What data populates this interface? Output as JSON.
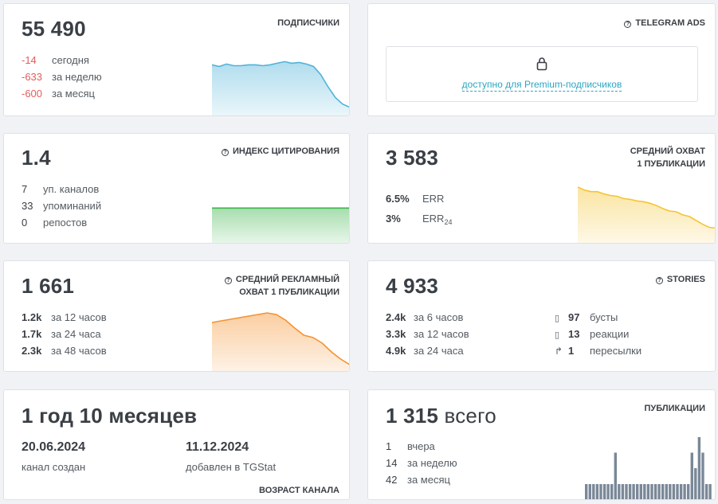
{
  "subscribers": {
    "value": "55 490",
    "label": "ПОДПИСЧИКИ",
    "stats": [
      {
        "value": "-14",
        "text": "сегодня"
      },
      {
        "value": "-633",
        "text": "за неделю"
      },
      {
        "value": "-600",
        "text": "за месяц"
      }
    ],
    "color": "#4fb3d9"
  },
  "ads": {
    "label": "TELEGRAM ADS",
    "locked_text": "доступно для Premium-подписчиков"
  },
  "citation": {
    "value": "1.4",
    "label": "ИНДЕКС ЦИТИРОВАНИЯ",
    "stats": [
      {
        "value": "7",
        "text": "уп. каналов"
      },
      {
        "value": "33",
        "text": "упоминаний"
      },
      {
        "value": "0",
        "text": "репостов"
      }
    ],
    "color": "#3cb54a"
  },
  "reach": {
    "value": "3 583",
    "label_line1": "СРЕДНИЙ ОХВАТ",
    "label_line2": "1 ПУБЛИКАЦИИ",
    "stats": [
      {
        "value": "6.5%",
        "text": "ERR",
        "sub": ""
      },
      {
        "value": "3%",
        "text": "ERR",
        "sub": "24"
      }
    ],
    "color": "#f5c431"
  },
  "ad_reach": {
    "value": "1 661",
    "label_line1": "СРЕДНИЙ РЕКЛАМНЫЙ",
    "label_line2": "ОХВАТ 1 ПУБЛИКАЦИИ",
    "stats": [
      {
        "value": "1.2k",
        "text": "за 12 часов"
      },
      {
        "value": "1.7k",
        "text": "за 24 часа"
      },
      {
        "value": "2.3k",
        "text": "за 48 часов"
      }
    ],
    "color": "#f5922f"
  },
  "stories": {
    "value": "4 933",
    "label": "STORIES",
    "stats": [
      {
        "value": "2.4k",
        "text": "за 6 часов"
      },
      {
        "value": "3.3k",
        "text": "за 12 часов"
      },
      {
        "value": "4.9k",
        "text": "за 24 часа"
      }
    ],
    "extra": [
      {
        "icon": "▯",
        "icon_name": "boost-icon",
        "value": "97",
        "text": "бусты"
      },
      {
        "icon": "▯",
        "icon_name": "reaction-icon",
        "value": "13",
        "text": "реакции"
      },
      {
        "icon": "↱",
        "icon_name": "share-icon",
        "value": "1",
        "text": "пересылки"
      }
    ]
  },
  "age": {
    "value": "1 год 10 месяцев",
    "created_date": "20.06.2024",
    "created_text": "канал создан",
    "added_date": "11.12.2024",
    "added_text": "добавлен в TGStat",
    "label": "ВОЗРАСТ КАНАЛА"
  },
  "posts": {
    "value": "1 315",
    "suffix": " всего",
    "label": "ПУБЛИКАЦИИ",
    "stats": [
      {
        "value": "1",
        "text": "вчера"
      },
      {
        "value": "14",
        "text": "за неделю"
      },
      {
        "value": "42",
        "text": "за месяц"
      }
    ],
    "color": "#7a8898"
  },
  "chart_data": [
    {
      "type": "area",
      "name": "subscribers-trend",
      "values": [
        62,
        60,
        63,
        61,
        61,
        62,
        62,
        61,
        62,
        64,
        66,
        64,
        65,
        63,
        60,
        50,
        35,
        22,
        14,
        10
      ]
    },
    {
      "type": "area",
      "name": "citation-trend",
      "values": [
        50,
        50,
        50,
        50,
        50,
        50,
        50,
        50,
        50,
        50,
        50,
        50,
        50,
        50,
        50,
        50,
        50,
        50,
        50,
        50
      ]
    },
    {
      "type": "area",
      "name": "reach-trend",
      "values": [
        72,
        68,
        66,
        66,
        63,
        61,
        60,
        57,
        56,
        54,
        53,
        51,
        48,
        44,
        41,
        40,
        36,
        34,
        29,
        24,
        20,
        19
      ]
    },
    {
      "type": "area",
      "name": "ad-reach-trend",
      "values": [
        62,
        64,
        66,
        68,
        70,
        72,
        74,
        72,
        65,
        55,
        46,
        43,
        36,
        25,
        16,
        9
      ]
    },
    {
      "type": "bar",
      "name": "posts-per-day",
      "values": [
        1,
        1,
        1,
        1,
        1,
        1,
        1,
        1,
        3,
        1,
        1,
        1,
        1,
        1,
        1,
        1,
        1,
        1,
        1,
        1,
        1,
        1,
        1,
        1,
        1,
        1,
        1,
        1,
        1,
        3,
        2,
        4,
        3,
        1,
        1
      ]
    }
  ]
}
